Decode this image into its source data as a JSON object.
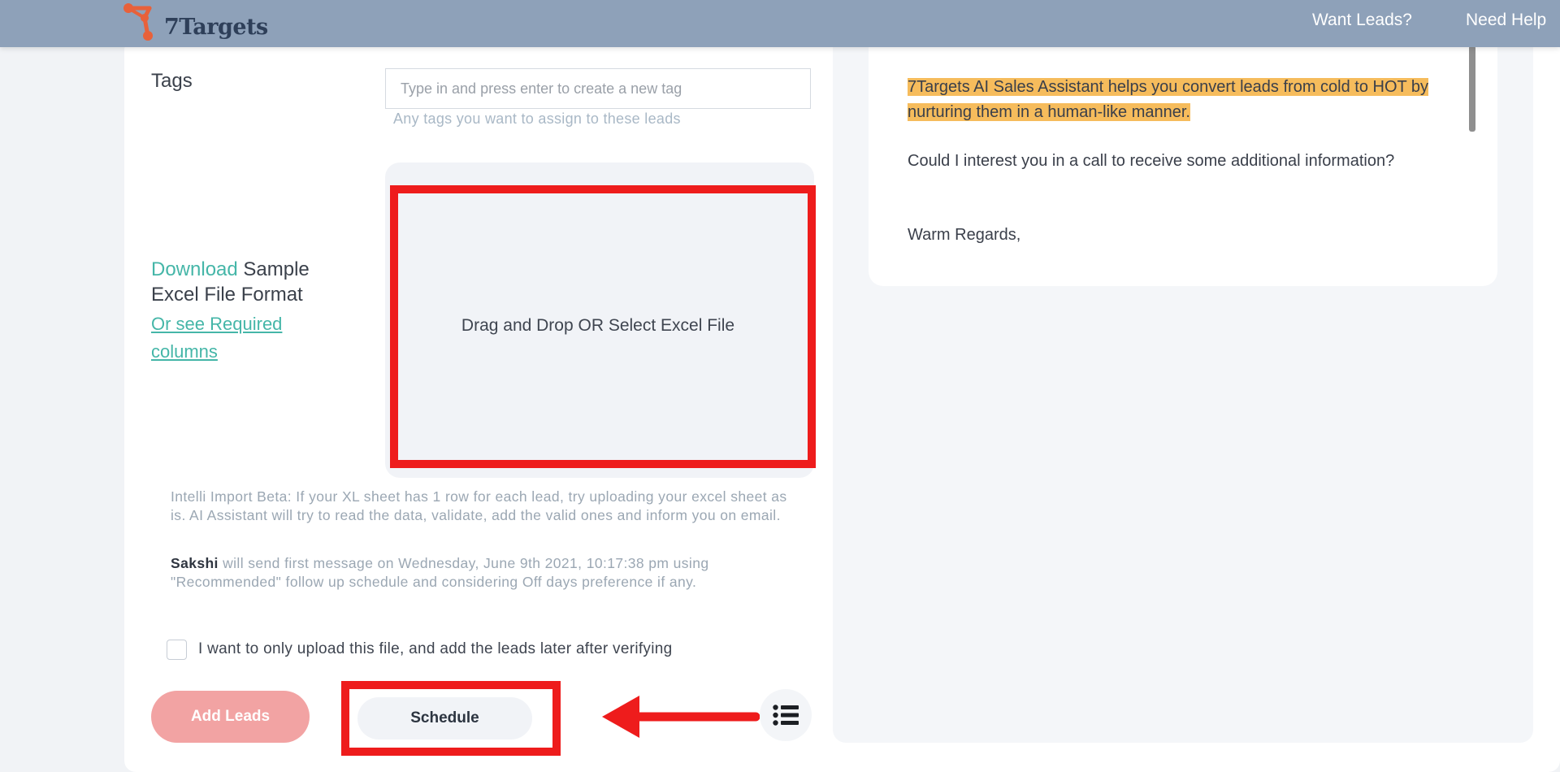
{
  "header": {
    "logo_text": "7Targets",
    "nav": [
      "Want Leads?",
      "Need Help"
    ]
  },
  "form": {
    "tags_label": "Tags",
    "tags_placeholder": "Type in and press enter to create a new tag",
    "tags_help": "Any tags you want to assign to these leads",
    "download_link": "Download",
    "download_rest": "Sample Excel File Format",
    "required_columns_link": "Or see Required columns",
    "dropzone_text": "Drag and Drop OR Select Excel File",
    "intelli_import": "Intelli Import Beta: If your XL sheet has 1 row for each lead, try uploading your excel sheet as is. AI Assistant will try to read the data, validate, add the valid ones and inform you on email.",
    "schedule_name": "Sakshi",
    "schedule_text": " will send first message on Wednesday, June 9th 2021, 10:17:38 pm using \"Recommended\" follow up schedule and considering Off days preference if any.",
    "checkbox_label": "I want to only upload this file, and add the leads later after verifying",
    "checkbox_checked": false,
    "add_leads_label": "Add Leads",
    "schedule_label": "Schedule"
  },
  "email_preview": {
    "highlighted": "7Targets AI Sales Assistant helps you convert leads from cold to HOT by nurturing them in a human-like manner.",
    "paragraph": "Could I interest you in a call to receive some additional information?",
    "signoff": "Warm Regards,"
  },
  "colors": {
    "header_bg": "#8ea1b9",
    "accent_teal": "#45b6a8",
    "annotation_red": "#ee1c1c",
    "highlight": "#f6bc5c",
    "add_leads_bg": "#f2a3a3"
  },
  "icons": [
    "logo-icon",
    "list-icon",
    "annotation-arrow-icon"
  ]
}
